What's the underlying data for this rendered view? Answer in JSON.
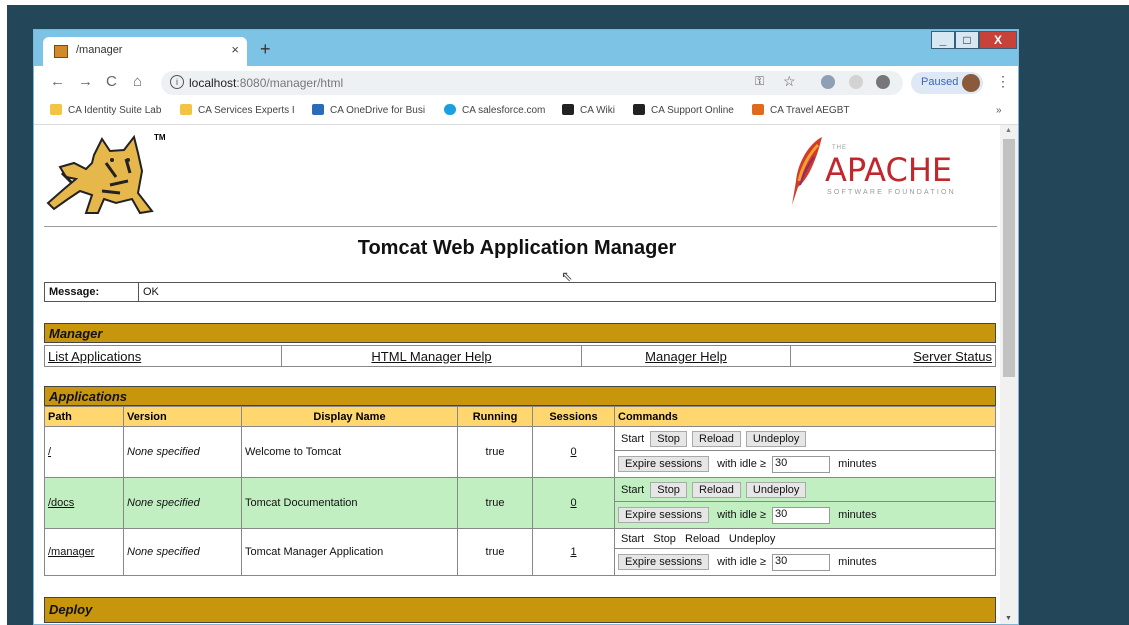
{
  "browser": {
    "tab_title": "/manager",
    "tab_close": "×",
    "new_tab": "+",
    "url_host": "localhost",
    "url_rest": ":8080/manager/html",
    "profile_label": "Paused",
    "bookmarks": [
      {
        "label": "CA Identity Suite Lab",
        "color": "#f3c343"
      },
      {
        "label": "CA Services Experts I",
        "color": "#f3c343"
      },
      {
        "label": "CA OneDrive for Busi",
        "color": "#2b6cb8"
      },
      {
        "label": "CA salesforce.com",
        "color": "#1aa0e0"
      },
      {
        "label": "CA Wiki",
        "color": "#222222"
      },
      {
        "label": "CA Support Online",
        "color": "#222222"
      },
      {
        "label": "CA Travel AEGBT",
        "color": "#e06a1c"
      }
    ],
    "more": "»"
  },
  "page": {
    "title": "Tomcat Web Application Manager",
    "logo_tm": "TM",
    "apache": {
      "the": "THE",
      "name": "APACHE",
      "sub": "SOFTWARE FOUNDATION"
    },
    "message_label": "Message:",
    "message_value": "OK"
  },
  "manager": {
    "heading": "Manager",
    "links": [
      "List Applications",
      "HTML Manager Help",
      "Manager Help",
      "Server Status"
    ]
  },
  "applications": {
    "heading": "Applications",
    "columns": [
      "Path",
      "Version",
      "Display Name",
      "Running",
      "Sessions",
      "Commands"
    ],
    "rows": [
      {
        "path": "/",
        "version": "None specified",
        "display_name": "Welcome to Tomcat",
        "running": "true",
        "sessions": "0"
      },
      {
        "path": "/docs",
        "version": "None specified",
        "display_name": "Tomcat Documentation",
        "running": "true",
        "sessions": "0"
      },
      {
        "path": "/manager",
        "version": "None specified",
        "display_name": "Tomcat Manager Application",
        "running": "true",
        "sessions": "1"
      }
    ],
    "commands": {
      "start": "Start",
      "stop": "Stop",
      "reload": "Reload",
      "undeploy": "Undeploy",
      "expire": "Expire sessions",
      "with_idle": "with idle ≥",
      "idle_value": "30",
      "minutes": "minutes"
    }
  },
  "deploy": {
    "heading": "Deploy"
  }
}
